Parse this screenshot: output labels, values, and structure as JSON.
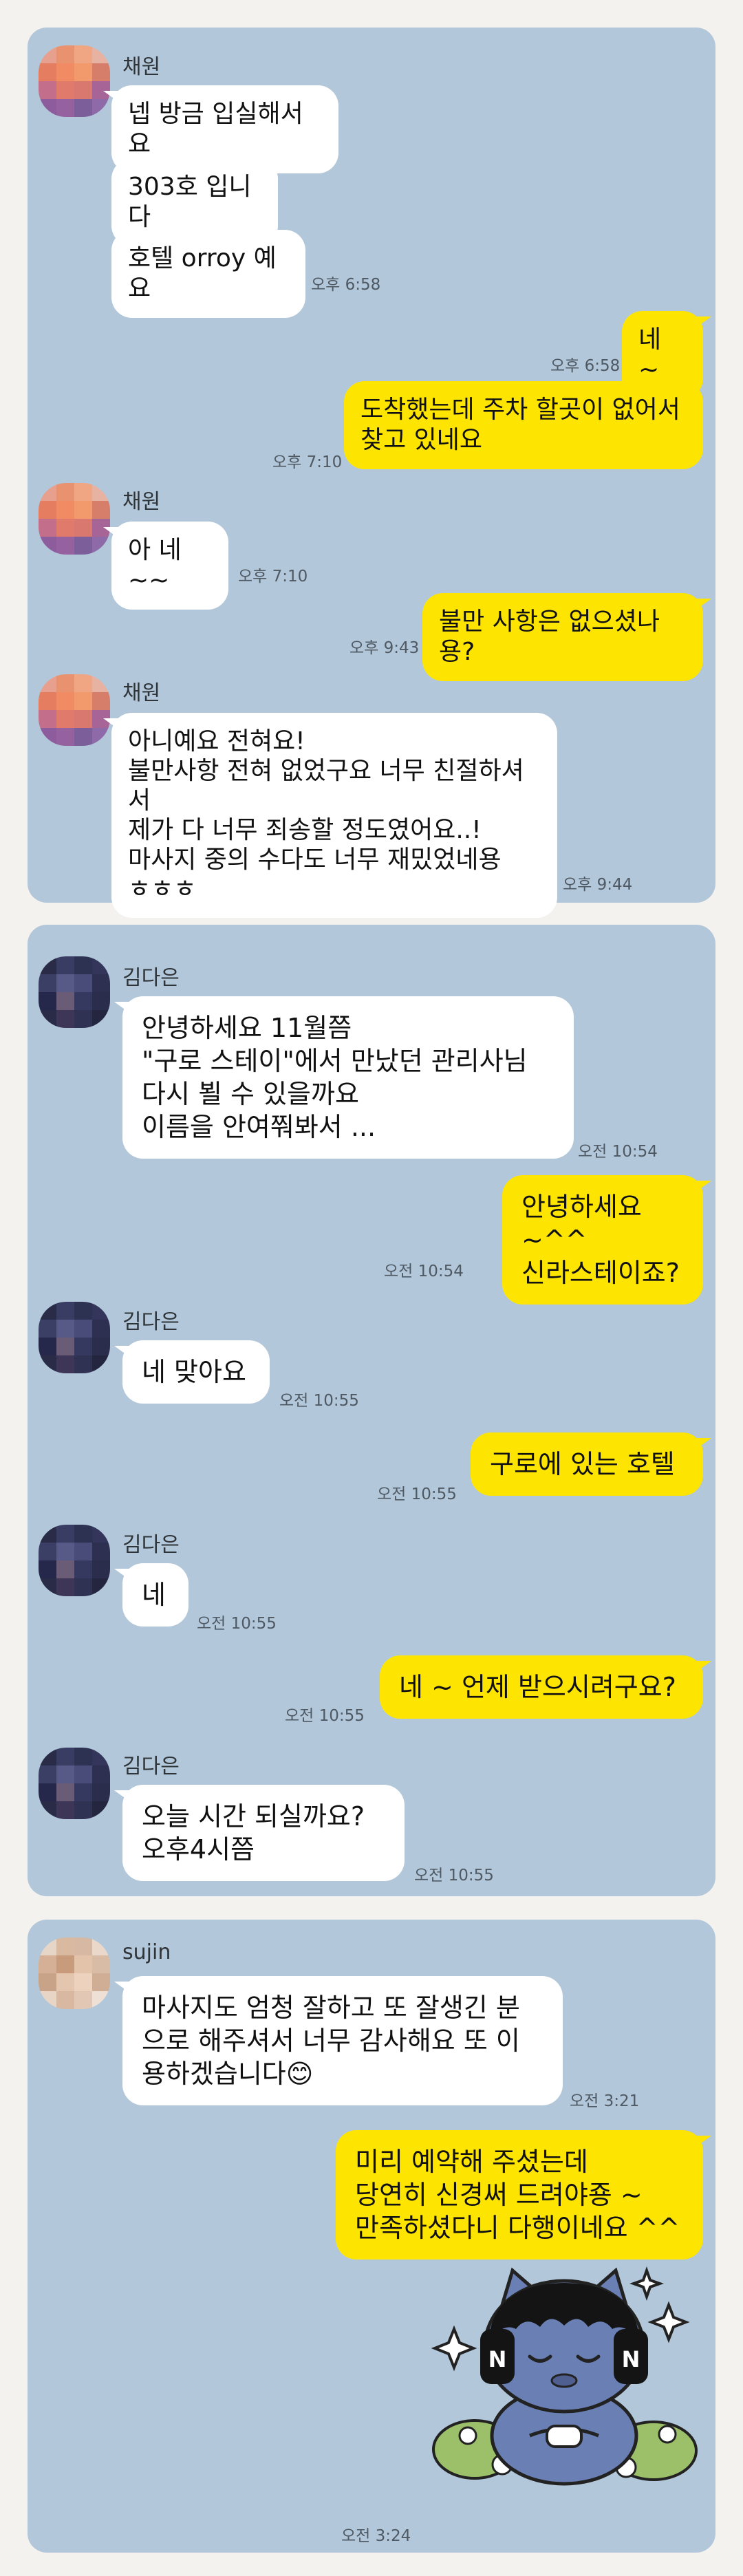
{
  "panel1": {
    "sender": "채원",
    "messages": [
      {
        "text": "넵 방금 입실해서요"
      },
      {
        "text": "303호 입니다"
      },
      {
        "text": "호텔 orroy 예요",
        "time": "오후 6:58"
      },
      {
        "text": "네 ~",
        "time": "오후 6:58"
      },
      {
        "text": "도착했는데  주차 할곳이 없어서\n찾고 있네요",
        "time": "오후 7:10"
      },
      {
        "text": "아 네~~",
        "time": "오후 7:10"
      },
      {
        "text": "불만 사항은 없으셨나용?",
        "time": "오후 9:43"
      },
      {
        "text": "아니예요 전혀요!\n불만사항 전혀 없었구요 너무 친절하셔서\n제가 다 너무 죄송할 정도였어요..!\n마사지 중의 수다도 너무 재밌었네용\nㅎㅎㅎ",
        "time": "오후 9:44"
      }
    ]
  },
  "panel2": {
    "sender": "김다은",
    "messages": [
      {
        "text": "안녕하세요 11월쯤\n\"구로 스테이\"에서 만났던 관리사님\n다시 뵐 수 있을까요\n이름을 안여쭤봐서 ...",
        "time": "오전 10:54"
      },
      {
        "text": "안녕하세요 ~^^\n신라스테이죠?",
        "time": "오전 10:54"
      },
      {
        "text": "네 맞아요",
        "time": "오전 10:55"
      },
      {
        "text": "구로에 있는 호텔",
        "time": "오전 10:55"
      },
      {
        "text": "네",
        "time": "오전 10:55"
      },
      {
        "text": "네 ~ 언제 받으시려구요?",
        "time": "오전 10:55"
      },
      {
        "text": "오늘  시간 되실까요?\n오후4시쯤",
        "time": "오전 10:55"
      }
    ]
  },
  "panel3": {
    "sender": "sujin",
    "messages": [
      {
        "text": "마사지도 엄청 잘하고 또 잘생긴 분\n으로 해주셔서 너무 감사해요 또 이\n용하겠습니다😊",
        "time": "오전 3:21"
      },
      {
        "text": "미리 예약해 주셨는데\n당연히 신경써 드려야죵 ~\n만족하셨다니 다행이네요 ^^",
        "time": ""
      },
      {
        "sticker": "cat-character-sticker",
        "time": "오전 3:24"
      }
    ]
  },
  "colors": {
    "chat_bg": "#b2c7d9",
    "incoming_bubble": "#ffffff",
    "outgoing_bubble": "#fee501",
    "page_bg": "#f4f2ef"
  }
}
